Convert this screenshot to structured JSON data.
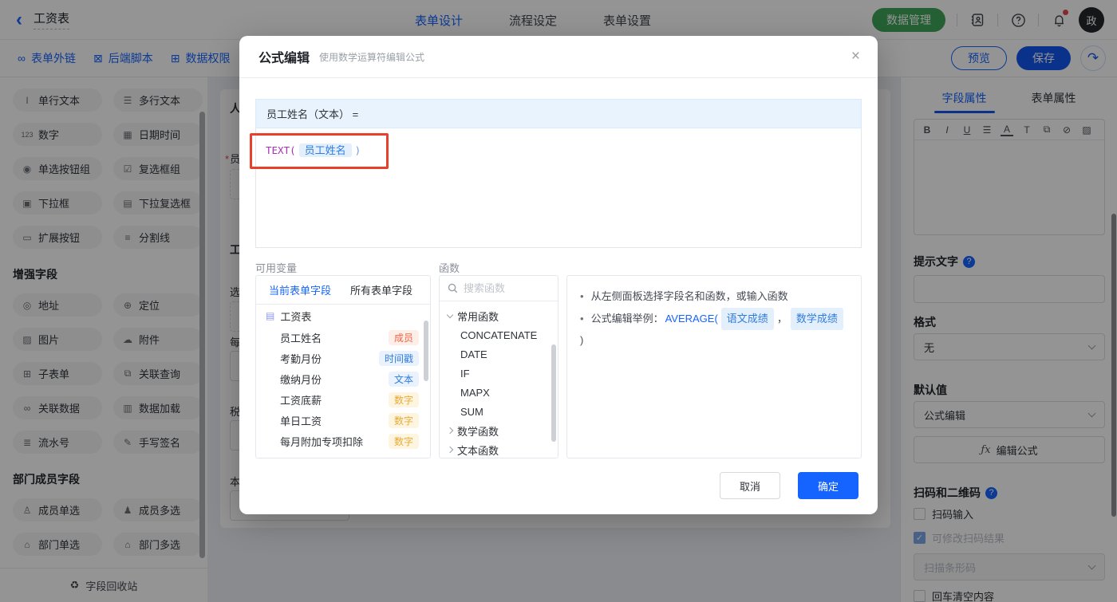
{
  "colors": {
    "accent": "#1664ff",
    "save_blue": "#1456f0",
    "green": "#3fa65b",
    "annotation_red": "#e8402a",
    "badge_member": "#f2654a",
    "badge_time_text": "#2e7ce0",
    "badge_number": "#e8a935"
  },
  "topbar": {
    "back": "‹",
    "title": "工资表",
    "tabs": [
      {
        "label": "表单设计"
      },
      {
        "label": "流程设定"
      },
      {
        "label": "表单设置"
      }
    ],
    "data_manage": "数据管理",
    "avatar": "政"
  },
  "subbar": {
    "links": [
      {
        "icon": "∞",
        "label": "表单外链"
      },
      {
        "icon": "⊠",
        "label": "后端脚本"
      },
      {
        "icon": "⊞",
        "label": "数据权限"
      }
    ],
    "preview": "预览",
    "save": "保存",
    "share_icon": "↷"
  },
  "sidebar": {
    "group1": {
      "items": [
        {
          "icon": "I",
          "label": "单行文本"
        },
        {
          "icon": "☰",
          "label": "多行文本"
        },
        {
          "icon": "123",
          "label": "数字"
        },
        {
          "icon": "▦",
          "label": "日期时间"
        },
        {
          "icon": "◉",
          "label": "单选按钮组"
        },
        {
          "icon": "☑",
          "label": "复选框组"
        },
        {
          "icon": "▣",
          "label": "下拉框"
        },
        {
          "icon": "▤",
          "label": "下拉复选框"
        },
        {
          "icon": "▭",
          "label": "扩展按钮"
        },
        {
          "icon": "≡",
          "label": "分割线"
        }
      ]
    },
    "group2": {
      "header": "增强字段",
      "items": [
        {
          "icon": "◎",
          "label": "地址"
        },
        {
          "icon": "⊕",
          "label": "定位"
        },
        {
          "icon": "▨",
          "label": "图片"
        },
        {
          "icon": "☁",
          "label": "附件"
        },
        {
          "icon": "⊞",
          "label": "子表单"
        },
        {
          "icon": "⧉",
          "label": "关联查询"
        },
        {
          "icon": "∞",
          "label": "关联数据"
        },
        {
          "icon": "▥",
          "label": "数据加载"
        },
        {
          "icon": "≣",
          "label": "流水号"
        },
        {
          "icon": "✎",
          "label": "手写签名"
        }
      ]
    },
    "group3": {
      "header": "部门成员字段",
      "items": [
        {
          "icon": "♙",
          "label": "成员单选"
        },
        {
          "icon": "♟",
          "label": "成员多选"
        },
        {
          "icon": "⌂",
          "label": "部门单选"
        },
        {
          "icon": "⌂",
          "label": "部门多选"
        }
      ]
    },
    "recycle_icon": "♻",
    "recycle": "字段回收站"
  },
  "canvas": {
    "required_mark": "*",
    "fragments": [
      {
        "text": "人"
      },
      {
        "text": "员"
      },
      {
        "text": "工"
      },
      {
        "text": "选"
      },
      {
        "text": "每"
      },
      {
        "text": "税"
      },
      {
        "text": "本"
      }
    ]
  },
  "modal": {
    "title": "公式编辑",
    "subtitle": "使用数学运算符编辑公式",
    "close": "×",
    "target": "员工姓名（文本） =",
    "formula": {
      "fn": "TEXT(",
      "chip": "员工姓名",
      "close": ")"
    },
    "variables": {
      "label": "可用变量",
      "tabs": [
        {
          "label": "当前表单字段"
        },
        {
          "label": "所有表单字段"
        }
      ],
      "root_icon": "▤",
      "root": "工资表",
      "fields": [
        {
          "name": "员工姓名",
          "badge": "成员"
        },
        {
          "name": "考勤月份",
          "badge": "时间戳"
        },
        {
          "name": "缴纳月份",
          "badge": "文本"
        },
        {
          "name": "工资底薪",
          "badge": "数字"
        },
        {
          "name": "单日工资",
          "badge": "数字"
        },
        {
          "name": "每月附加专项扣除",
          "badge": "数字"
        }
      ]
    },
    "functions": {
      "label": "函数",
      "search_placeholder": "搜索函数",
      "group_common": "常用函数",
      "common_items": [
        "CONCATENATE",
        "DATE",
        "IF",
        "MAPX",
        "SUM"
      ],
      "group_math": "数学函数",
      "group_text": "文本函数"
    },
    "help": {
      "line1": "从左侧面板选择字段名和函数，或输入函数",
      "line2_prefix": "公式编辑举例：",
      "line2_fn": "AVERAGE(",
      "chip1": "语文成绩",
      "comma": "，",
      "chip2": "数学成绩",
      "close": ")"
    },
    "cancel": "取消",
    "ok": "确定"
  },
  "right_panel": {
    "tabs": [
      {
        "label": "字段属性"
      },
      {
        "label": "表单属性"
      }
    ],
    "richtext_icons": [
      "B",
      "I",
      "U",
      "☰",
      "A",
      "T",
      "⧉",
      "⊘",
      "▨"
    ],
    "hint_label": "提示文字",
    "format_label": "格式",
    "format_value": "无",
    "default_label": "默认值",
    "default_value": "公式编辑",
    "fx_glyph": "ƒx",
    "edit_formula": "编辑公式",
    "scan_label": "扫码和二维码",
    "checkbox_scan": "扫码输入",
    "checkbox_modify": "可修改扫码结果",
    "check_glyph": "✓",
    "scan_select": "扫描条形码",
    "checkbox_clear": "回车清空内容"
  }
}
